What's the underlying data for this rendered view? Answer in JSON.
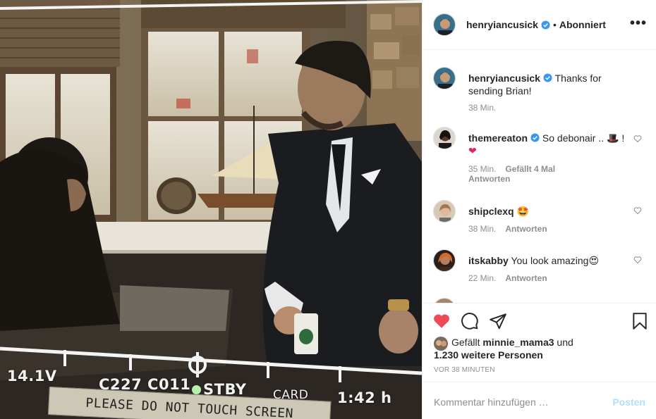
{
  "photo": {
    "hud": {
      "voltage": "14.1V",
      "clip": "C227  C011",
      "status": "STBY",
      "media": "CARD",
      "remaining": "1:42 h"
    },
    "sticker_text": "PLEASE DO NOT TOUCH SCREEN"
  },
  "header": {
    "username": "henryiancusick",
    "separator": "•",
    "follow_state": "Abonniert",
    "more_icon": "more-horizontal-icon"
  },
  "comments": [
    {
      "username": "henryiancusick",
      "verified": true,
      "text": "Thanks for sending Brian!",
      "time": "38 Min.",
      "likes": "",
      "reply": ""
    },
    {
      "username": "themereaton",
      "verified": true,
      "text_before": "So debonair ..",
      "emoji1": "🎩",
      "text_mid": "!",
      "emoji2": "❤",
      "time": "35 Min.",
      "likes": "Gefällt 4 Mal",
      "reply": "Antworten"
    },
    {
      "username": "shipclexq",
      "verified": false,
      "text": "",
      "emoji": "🤩",
      "time": "38 Min.",
      "reply": "Antworten"
    },
    {
      "username": "itskabby",
      "verified": false,
      "text": "You look amazing",
      "emoji": "😍",
      "time": "22 Min.",
      "reply": "Antworten"
    }
  ],
  "actions": {
    "like_icon": "heart-filled-icon",
    "comment_icon": "comment-icon",
    "share_icon": "paper-plane-icon",
    "save_icon": "bookmark-icon",
    "like_color": "#ed4956"
  },
  "likes": {
    "prefix": "Gefällt",
    "user": "minnie_mama3",
    "conj": "und",
    "others": "1.230 weitere Personen"
  },
  "posted_ago": "VOR 38 MINUTEN",
  "add_comment": {
    "placeholder": "Kommentar hinzufügen …",
    "post_label": "Posten"
  },
  "colors": {
    "verified": "#3897f0",
    "muted": "#8e8e8e",
    "post_disabled": "#b2dffc"
  }
}
